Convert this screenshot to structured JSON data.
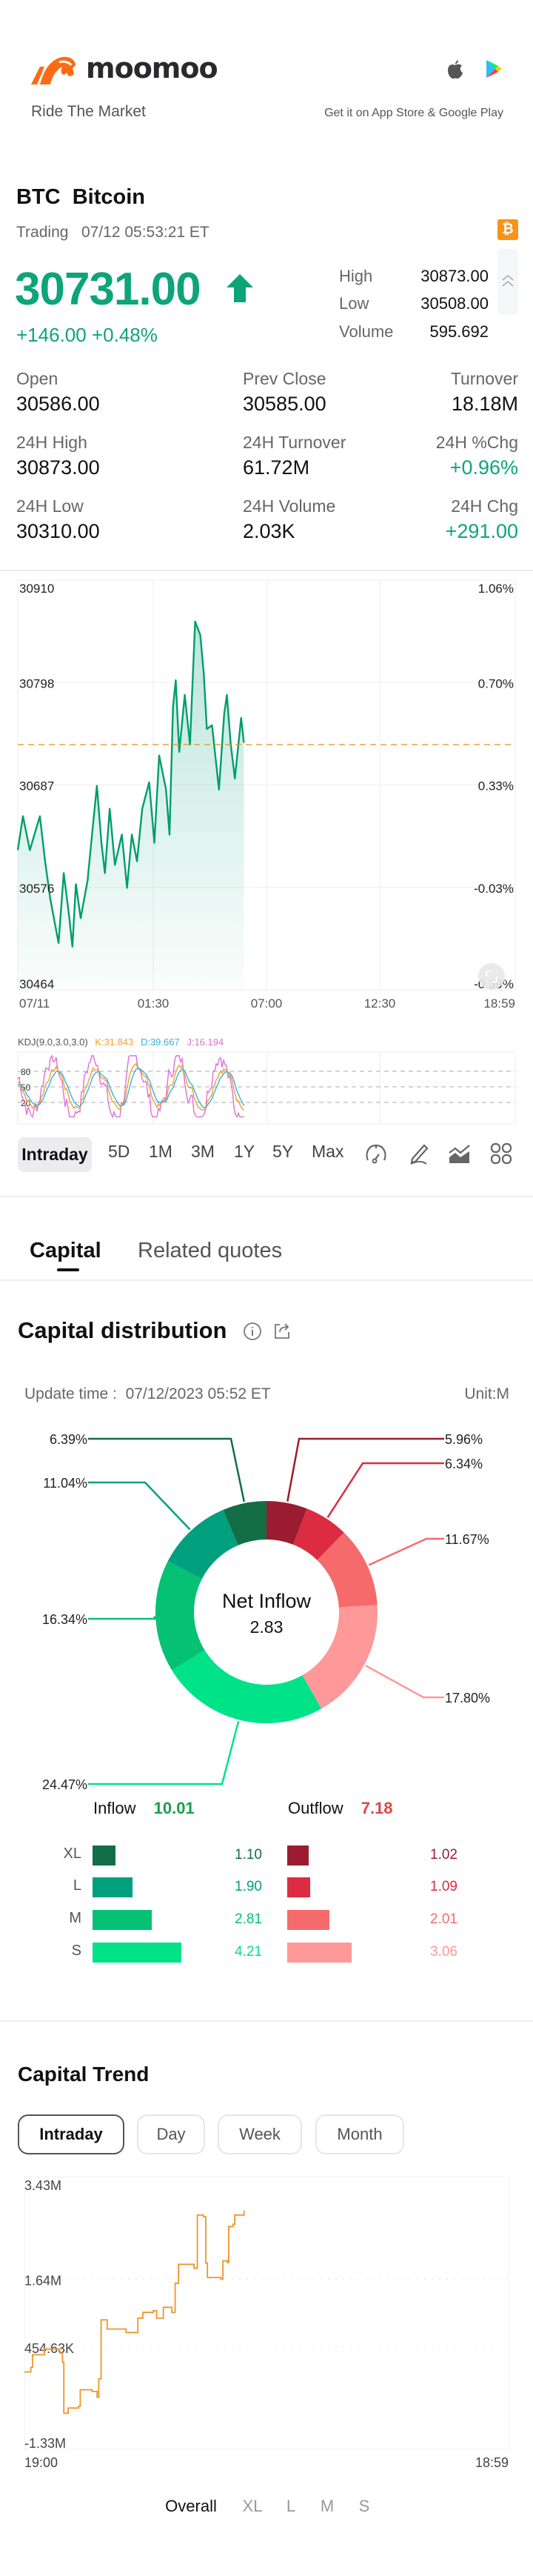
{
  "header": {
    "brand": "moomoo",
    "tagline": "Ride The Market",
    "store_text": "Get it on App Store & Google Play",
    "icons": [
      "apple-icon",
      "google-play-icon"
    ]
  },
  "quote": {
    "symbol": "BTC",
    "name": "Bitcoin",
    "status": "Trading",
    "timestamp": "07/12 05:53:21 ET",
    "price": "30731.00",
    "change": "+146.00",
    "change_pct": "+0.48%",
    "high_label": "High",
    "high": "30873.00",
    "low_label": "Low",
    "low": "30508.00",
    "volume_label": "Volume",
    "volume": "595.692",
    "up_color": "#0ea47a"
  },
  "stats": [
    {
      "label": "Open",
      "value": "30586.00"
    },
    {
      "label": "Prev Close",
      "value": "30585.00"
    },
    {
      "label": "Turnover",
      "value": "18.18M"
    },
    {
      "label": "24H High",
      "value": "30873.00"
    },
    {
      "label": "24H Turnover",
      "value": "61.72M"
    },
    {
      "label": "24H %Chg",
      "value": "+0.96%",
      "positive": true
    },
    {
      "label": "24H Low",
      "value": "30310.00"
    },
    {
      "label": "24H Volume",
      "value": "2.03K"
    },
    {
      "label": "24H Chg",
      "value": "+291.00",
      "positive": true
    }
  ],
  "chart_data": [
    {
      "type": "area",
      "y_ticks": [
        "30910",
        "30798",
        "30687",
        "30576",
        "30464"
      ],
      "y_right_ticks": [
        "1.06%",
        "0.70%",
        "0.33%",
        "-0.03%",
        "-0.39%"
      ],
      "x_ticks": [
        "07/11",
        "01:30",
        "07:00",
        "12:30",
        "18:59"
      ],
      "ylim": [
        30464,
        30910
      ],
      "xlim": [
        "19:00",
        "18:59"
      ],
      "reference_line": 30731,
      "grid": true,
      "line_color": "#009e6b",
      "points": [
        [
          "19:00",
          30616
        ],
        [
          "19:15",
          30653
        ],
        [
          "19:35",
          30616
        ],
        [
          "20:04",
          30653
        ],
        [
          "20:19",
          30604
        ],
        [
          "20:34",
          30563
        ],
        [
          "20:58",
          30515
        ],
        [
          "21:13",
          30591
        ],
        [
          "21:28",
          30546
        ],
        [
          "21:38",
          30511
        ],
        [
          "21:48",
          30579
        ],
        [
          "22:02",
          30542
        ],
        [
          "22:22",
          30583
        ],
        [
          "22:37",
          30641
        ],
        [
          "22:49",
          30686
        ],
        [
          "23:02",
          30624
        ],
        [
          "23:12",
          30591
        ],
        [
          "23:26",
          30661
        ],
        [
          "23:41",
          30600
        ],
        [
          "00:01",
          30633
        ],
        [
          "00:16",
          30575
        ],
        [
          "00:30",
          30633
        ],
        [
          "00:45",
          30604
        ],
        [
          "01:00",
          30661
        ],
        [
          "01:20",
          30690
        ],
        [
          "01:35",
          30624
        ],
        [
          "01:49",
          30719
        ],
        [
          "02:09",
          30682
        ],
        [
          "02:19",
          30633
        ],
        [
          "02:29",
          30772
        ],
        [
          "02:37",
          30801
        ],
        [
          "02:47",
          30723
        ],
        [
          "03:03",
          30785
        ],
        [
          "03:18",
          30731
        ],
        [
          "03:33",
          30865
        ],
        [
          "03:48",
          30850
        ],
        [
          "03:58",
          30809
        ],
        [
          "04:07",
          30748
        ],
        [
          "04:22",
          30752
        ],
        [
          "04:42",
          30682
        ],
        [
          "04:57",
          30764
        ],
        [
          "05:05",
          30785
        ],
        [
          "05:16",
          30731
        ],
        [
          "05:28",
          30694
        ],
        [
          "05:46",
          30760
        ],
        [
          "05:54",
          30733
        ]
      ]
    },
    {
      "type": "line",
      "indicator": "KDJ(9.0,3.0,3.0)",
      "k_label": "K:31.843",
      "d_label": "D:39.667",
      "j_label": "J:16.194",
      "k_color": "#f0a030",
      "d_color": "#3ab0e0",
      "j_color": "#e070d8",
      "levels": [
        "80",
        "50",
        "20"
      ]
    },
    {
      "type": "pie",
      "center_label": "Net Inflow",
      "center_value": "2.83",
      "slices": [
        {
          "group": "Outflow",
          "size": "XL",
          "pct": 5.96,
          "label": "5.96%",
          "color": "#9b1c30"
        },
        {
          "group": "Outflow",
          "size": "L",
          "pct": 6.34,
          "label": "6.34%",
          "color": "#dc2c41"
        },
        {
          "group": "Outflow",
          "size": "M",
          "pct": 11.67,
          "label": "11.67%",
          "color": "#f56b6b"
        },
        {
          "group": "Outflow",
          "size": "S",
          "pct": 17.8,
          "label": "17.80%",
          "color": "#ff9898"
        },
        {
          "group": "Inflow",
          "size": "S",
          "pct": 24.47,
          "label": "24.47%",
          "color": "#00e288"
        },
        {
          "group": "Inflow",
          "size": "M",
          "pct": 16.34,
          "label": "16.34%",
          "color": "#05c174"
        },
        {
          "group": "Inflow",
          "size": "L",
          "pct": 11.04,
          "label": "11.04%",
          "color": "#00a07e"
        },
        {
          "group": "Inflow",
          "size": "XL",
          "pct": 6.39,
          "label": "6.39%",
          "color": "#136e45"
        }
      ]
    },
    {
      "type": "bar",
      "categories": [
        "XL",
        "L",
        "M",
        "S"
      ],
      "series": [
        {
          "name": "Inflow",
          "values": [
            1.1,
            1.9,
            2.81,
            4.21
          ],
          "labels": [
            "1.10",
            "1.90",
            "2.81",
            "4.21"
          ],
          "colors": [
            "#136e45",
            "#00a07e",
            "#05c174",
            "#00e288"
          ]
        },
        {
          "name": "Outflow",
          "values": [
            1.02,
            1.09,
            2.01,
            3.06
          ],
          "labels": [
            "1.02",
            "1.09",
            "2.01",
            "3.06"
          ],
          "colors": [
            "#9b1c30",
            "#dc2c41",
            "#f56b6b",
            "#ff9898"
          ]
        }
      ]
    },
    {
      "type": "line",
      "y_ticks": [
        "3.43M",
        "1.64M",
        "454.63K",
        "-1.33M"
      ],
      "y_tick_values": [
        3.43,
        1.64,
        0.45463,
        -1.33
      ],
      "ylim": [
        -1.33,
        3.43
      ],
      "x_ticks": [
        "19:00",
        "18:59"
      ],
      "xlim": [
        "19:00",
        "18:59"
      ],
      "line_color": "#f0952a",
      "unit": "M",
      "points": [
        [
          "19:00",
          0.02
        ],
        [
          "19:19",
          0.1
        ],
        [
          "19:24",
          0.32
        ],
        [
          "19:59",
          0.42
        ],
        [
          "20:45",
          0.35
        ],
        [
          "20:53",
          0.19
        ],
        [
          "20:57",
          -0.7
        ],
        [
          "21:10",
          -0.61
        ],
        [
          "21:41",
          -0.58
        ],
        [
          "21:46",
          -0.29
        ],
        [
          "22:21",
          -0.32
        ],
        [
          "22:36",
          -0.42
        ],
        [
          "22:41",
          -0.1
        ],
        [
          "22:48",
          0.93
        ],
        [
          "23:06",
          0.77
        ],
        [
          "23:32",
          0.77
        ],
        [
          "00:02",
          0.71
        ],
        [
          "00:22",
          0.71
        ],
        [
          "00:37",
          0.96
        ],
        [
          "00:52",
          1.06
        ],
        [
          "01:23",
          1.09
        ],
        [
          "01:33",
          0.96
        ],
        [
          "01:53",
          1.15
        ],
        [
          "02:18",
          1.06
        ],
        [
          "02:28",
          1.57
        ],
        [
          "02:38",
          1.9
        ],
        [
          "03:24",
          1.83
        ],
        [
          "03:34",
          2.76
        ],
        [
          "03:52",
          2.73
        ],
        [
          "03:59",
          1.92
        ],
        [
          "04:04",
          1.67
        ],
        [
          "04:44",
          1.64
        ],
        [
          "04:50",
          1.96
        ],
        [
          "05:03",
          1.93
        ],
        [
          "05:07",
          2.56
        ],
        [
          "05:20",
          2.6
        ],
        [
          "05:25",
          2.76
        ],
        [
          "05:53",
          2.84
        ]
      ]
    }
  ],
  "chart_toolbar": {
    "ranges": [
      "Intraday",
      "5D",
      "1M",
      "3M",
      "1Y",
      "5Y",
      "Max"
    ],
    "active": "Intraday",
    "icons": [
      "gauge-icon",
      "draw-pen-icon",
      "chart-type-icon",
      "grid-apps-icon"
    ]
  },
  "section_tabs": [
    {
      "label": "Capital",
      "active": true
    },
    {
      "label": "Related quotes"
    }
  ],
  "capital_distribution": {
    "title": "Capital distribution",
    "update_label": "Update time :",
    "update_time": "07/12/2023 05:52 ET",
    "unit": "Unit:M",
    "inflow_label": "Inflow",
    "inflow_total": "10.01",
    "inflow_color": "#18a04a",
    "outflow_label": "Outflow",
    "outflow_total": "7.18",
    "outflow_color": "#e04545"
  },
  "capital_trend": {
    "title": "Capital Trend",
    "periods": [
      "Intraday",
      "Day",
      "Week",
      "Month"
    ],
    "active_period": "Intraday",
    "legend": [
      "Overall",
      "XL",
      "L",
      "M",
      "S"
    ],
    "active_legend": "Overall"
  }
}
